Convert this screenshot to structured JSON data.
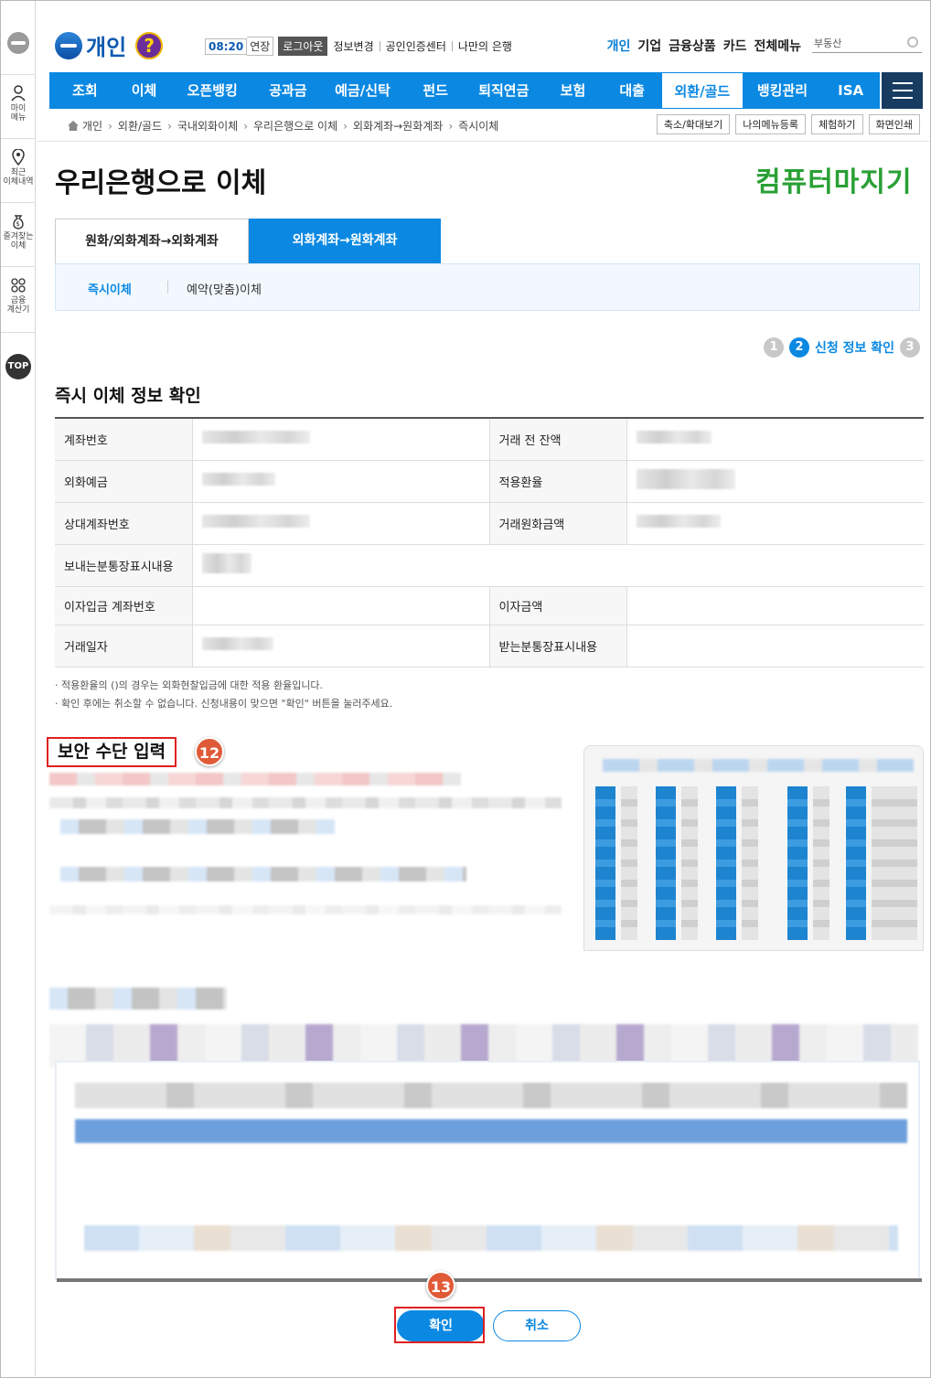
{
  "header": {
    "brand": "개인",
    "help_icon": "?",
    "session_time": "08:20",
    "extend_label": "연장",
    "logout_label": "로그아웃",
    "util_links": [
      "정보변경",
      "공인인증센터",
      "나만의 은행"
    ],
    "gnb": [
      "개인",
      "기업",
      "금융상품",
      "카드",
      "전체메뉴"
    ],
    "search_placeholder": "부동산"
  },
  "sidebar": {
    "items": [
      {
        "label": "마이\n메뉴",
        "icon": "person-icon"
      },
      {
        "label": "최근\n이체내역",
        "icon": "location-pin-icon"
      },
      {
        "label": "즐겨찾는\n이체",
        "icon": "money-bag-icon"
      },
      {
        "label": "금융\n계산기",
        "icon": "calculator-icon"
      }
    ],
    "top_label": "TOP"
  },
  "nav": {
    "items": [
      "조회",
      "이체",
      "오픈뱅킹",
      "공과금",
      "예금/신탁",
      "펀드",
      "퇴직연금",
      "보험",
      "대출",
      "외환/골드",
      "뱅킹관리",
      "ISA"
    ],
    "active": "외환/골드"
  },
  "breadcrumb": {
    "items": [
      "개인",
      "외환/골드",
      "국내외화이체",
      "우리은행으로 이체",
      "외화계좌→원화계좌",
      "즉시이체"
    ],
    "tools": [
      "축소/확대보기",
      "나의메뉴등록",
      "체험하기",
      "화면인쇄"
    ]
  },
  "page": {
    "title": "우리은행으로 이체",
    "mascot": "컴퓨터마지기",
    "tabs": [
      "원화/외화계좌→외화계좌",
      "외화계좌→원화계좌"
    ],
    "subtabs": [
      "즉시이체",
      "예약(맞춤)이체"
    ]
  },
  "steps": {
    "items": [
      "1",
      "2",
      "3"
    ],
    "current_label": "신청 정보 확인"
  },
  "confirm": {
    "section_title": "즉시 이체 정보 확인",
    "labels": {
      "account_no": "계좌번호",
      "balance_before": "거래 전 잔액",
      "fx_deposit": "외화예금",
      "applied_rate": "적용환율",
      "counter_account": "상대계좌번호",
      "krw_amount": "거래원화금액",
      "sender_memo": "보내는분통장표시내용",
      "interest_account": "이자입금 계좌번호",
      "interest_amount": "이자금액",
      "trade_date": "거래일자",
      "receiver_memo": "받는분통장표시내용"
    },
    "notes": [
      "· 적용환율의 ()의 경우는 외화현찰입금에 대한 적용 환율입니다.",
      "· 확인 후에는 취소할 수 없습니다. 신청내용이 맞으면 \"확인\" 버튼을 눌러주세요."
    ]
  },
  "security": {
    "title": "보안 수단 입력"
  },
  "annotations": {
    "step12": "12",
    "step13": "13"
  },
  "buttons": {
    "ok": "확인",
    "cancel": "취소"
  },
  "colors": {
    "primary": "#0a88e2",
    "nav_dark": "#183b62",
    "highlight": "#e02020",
    "badge": "#e05a38"
  }
}
